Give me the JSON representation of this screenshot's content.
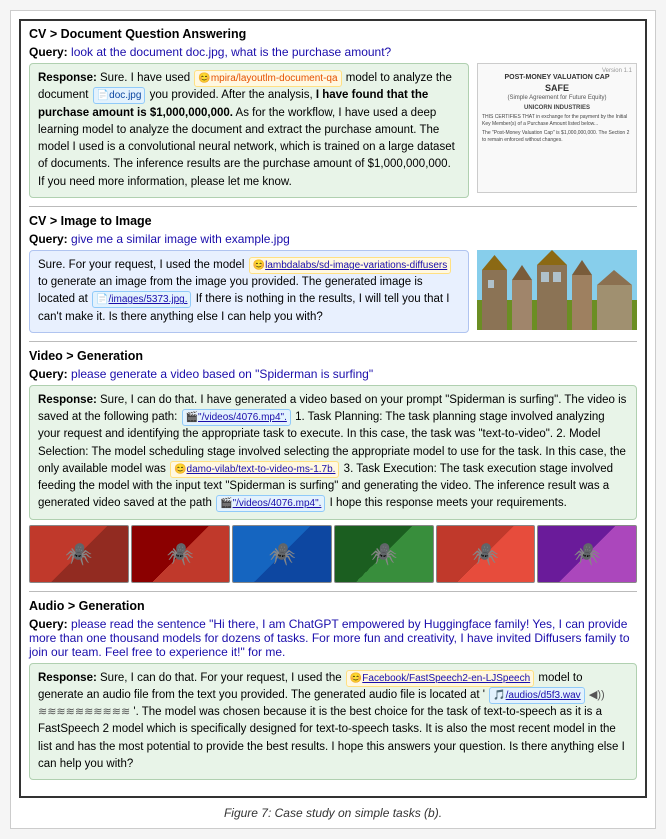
{
  "figure_caption": "Figure 7: Case study on simple tasks (b).",
  "section1": {
    "breadcrumb": "CV > Document Question Answering",
    "query_label": "Query:",
    "query_text": "look at the document doc.jpg, what is the purchase amount?",
    "response_label": "Response:",
    "response_text_1": "Sure. I have used",
    "model_name": "mpira/layoutlm-document-qa",
    "response_text_2": "model to analyze the document",
    "file_name": "doc.jpg",
    "response_text_3": "you provided. After the analysis,",
    "bold_text": "I have found that the purchase amount is $1,000,000,000.",
    "response_text_4": "As for the workflow, I have used a deep learning model to analyze the document and extract the purchase amount. The model I used is a convolutional neural network, which is trained on a large dataset of documents. The inference results are the purchase amount of $1,000,000,000. If you need more information, please let me know.",
    "doc_title": "POST-MONEY VALUATION CAP",
    "doc_safe": "SAFE",
    "doc_subtitle": "(Simple Agreement for Future Equity)",
    "doc_company": "UNICORN INDUSTRIES"
  },
  "section2": {
    "breadcrumb": "CV > Image to Image",
    "query_label": "Query:",
    "query_text": "give me a similar image with example.jpg",
    "response_label": "",
    "response_text_1": "Sure. For your request, I used the model",
    "model_name": "lambdalabs/sd-image-variations-diffusers",
    "response_text_2": "to generate an image from the image you provided. The generated image is located at",
    "file_path": "/images/5373.jpg.",
    "response_text_3": "If there is nothing in the results, I will tell you that I can't make it. Is there anything else I can help you with?"
  },
  "section3": {
    "breadcrumb": "Video > Generation",
    "query_label": "Query:",
    "query_text": "please generate a video based on \"Spiderman is surfing\"",
    "response_label": "Response:",
    "response_text": "Sure, I can do that. I have generated a video based on your prompt \"Spiderman is surfing\". The video is saved at the following path:",
    "file_path": "\"/videos/4076.mp4\".",
    "task_text": "1. Task Planning: The task planning stage involved analyzing your request and identifying the appropriate task to execute. In this case, the task was \"text-to-video\". 2. Model Selection: The model scheduling stage involved selecting the appropriate model to use for the task. In this case, the only available model was",
    "model_name": "damo-vilab/text-to-video-ms-1.7b.",
    "task_text2": "3. Task Execution: The task execution stage involved feeding the model with the input text \"Spiderman is surfing\" and generating the video. The inference result was a generated video saved at the path",
    "file_path2": "\"/videos/4076.mp4\".",
    "ending": "I hope this response meets your requirements."
  },
  "section4": {
    "breadcrumb": "Audio > Generation",
    "query_label": "Query:",
    "query_text": "please read the sentence \"Hi there, I am ChatGPT empowered by Huggingface family! Yes, I can provide more than one thousand models for dozens of tasks. For more fun and creativity, I have invited Diffusers family to join our team. Feel free to experience it!\" for me.",
    "response_label": "Response:",
    "response_text_1": "Sure, I can do that. For your request, I used the",
    "model_name": "Facebook/FastSpeech2-en-LJSpeech",
    "response_text_2": "model to generate an audio file from the text you provided. The generated audio file is located at '",
    "file_path": "/audios/d5f3.wav",
    "wave_symbol": "◀)) ≋ ≋ ≋ ≋ ≋ ≋",
    "response_text_3": "'. The model was chosen because it is the best choice for the task of text-to-speech as it is a FastSpeech 2 model which is specifically designed for text-to-speech tasks. It is also the most recent model in the list and has the most potential to provide the best results. I hope this answers your question. Is there anything else I can help you with?"
  },
  "icons": {
    "emoji_face": "😊",
    "file_icon": "📄",
    "video_icon": "🎬",
    "audio_icon": "🎵",
    "spiderman_emoji": "🕷️"
  }
}
